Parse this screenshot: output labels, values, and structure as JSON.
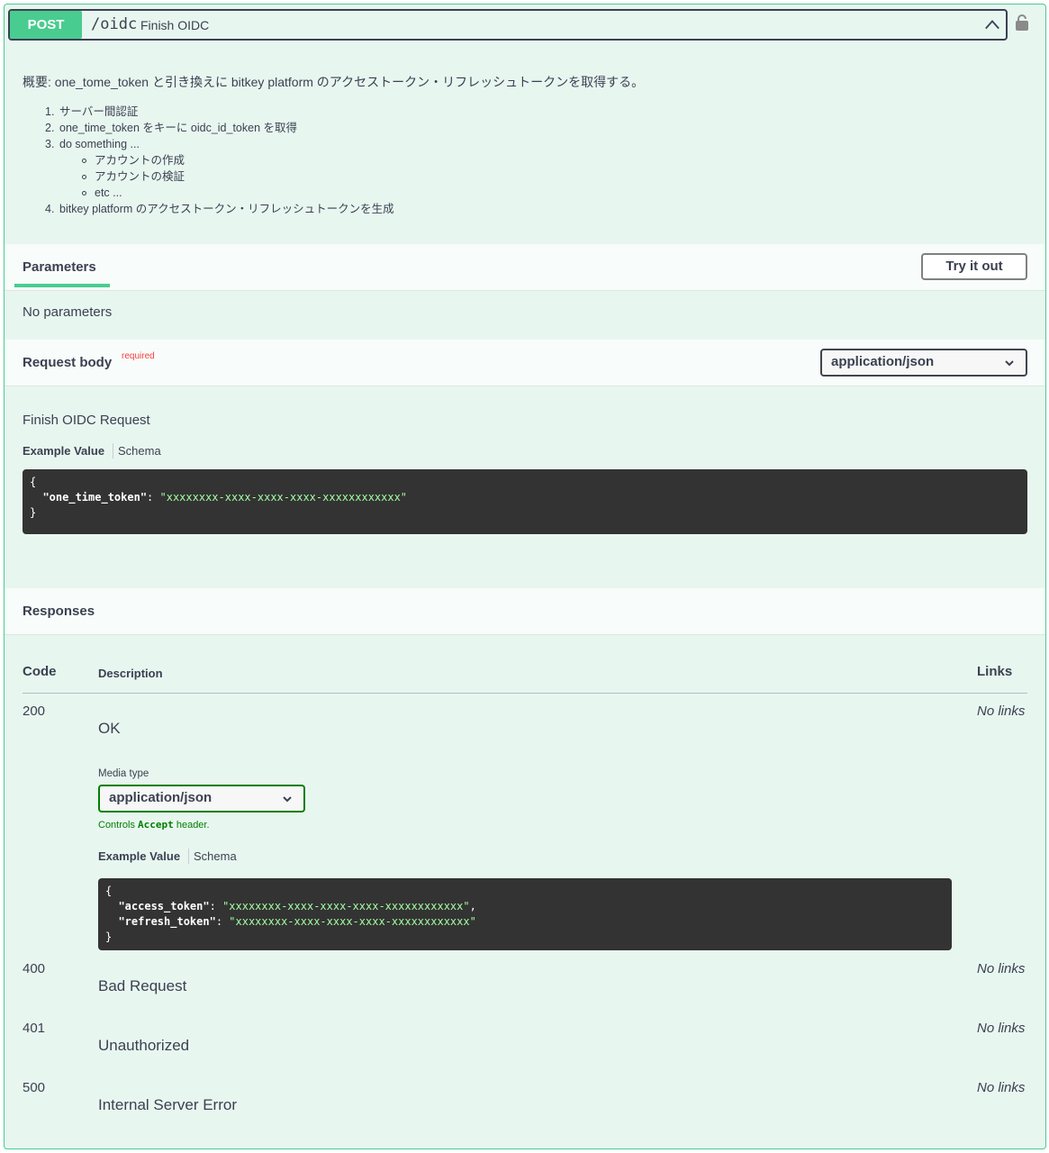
{
  "summary": {
    "method": "POST",
    "path": "/oidc",
    "description": "Finish OIDC"
  },
  "description": {
    "main": "概要: one_tome_token と引き換えに bitkey platform のアクセストークン・リフレッシュトークンを取得する。",
    "items": [
      {
        "num": "1.",
        "text": "サーバー間認証"
      },
      {
        "num": "2.",
        "text": "one_time_token をキーに oidc_id_token を取得"
      },
      {
        "num": "3.",
        "text": "do something ..."
      },
      {
        "num": "4.",
        "text": "bitkey platform のアクセストークン・リフレッシュトークンを生成"
      }
    ],
    "subitems": [
      "アカウントの作成",
      "アカウントの検証",
      "etc ..."
    ]
  },
  "parameters": {
    "tab_label": "Parameters",
    "try_button": "Try it out",
    "empty_text": "No parameters"
  },
  "request_body": {
    "title": "Request body",
    "required": "required",
    "content_type": "application/json",
    "description": "Finish OIDC Request",
    "example_tab": "Example Value",
    "schema_tab": "Schema",
    "example": {
      "open": "{",
      "key": "\"one_time_token\"",
      "value": "\"xxxxxxxx-xxxx-xxxx-xxxx-xxxxxxxxxxxx\"",
      "close": "}"
    }
  },
  "responses": {
    "title": "Responses",
    "col_code": "Code",
    "col_description": "Description",
    "col_links": "Links",
    "media_type_label": "Media type",
    "media_type": "application/json",
    "controls_prefix": "Controls ",
    "controls_accept": "Accept",
    "controls_suffix": " header.",
    "example_tab": "Example Value",
    "schema_tab": "Schema",
    "example": {
      "open": "{",
      "key1": "\"access_token\"",
      "value1": "\"xxxxxxxx-xxxx-xxxx-xxxx-xxxxxxxxxxxx\"",
      "key2": "\"refresh_token\"",
      "value2": "\"xxxxxxxx-xxxx-xxxx-xxxx-xxxxxxxxxxxx\"",
      "close": "}"
    },
    "rows": [
      {
        "code": "200",
        "description": "OK",
        "links": "No links"
      },
      {
        "code": "400",
        "description": "Bad Request",
        "links": "No links"
      },
      {
        "code": "401",
        "description": "Unauthorized",
        "links": "No links"
      },
      {
        "code": "500",
        "description": "Internal Server Error",
        "links": "No links"
      }
    ]
  },
  "colors": {
    "accent": "#49cc90",
    "background": "#e8f6f0",
    "required": "#f93e3e",
    "code_bg": "#333333",
    "code_string": "#a2fca2"
  }
}
